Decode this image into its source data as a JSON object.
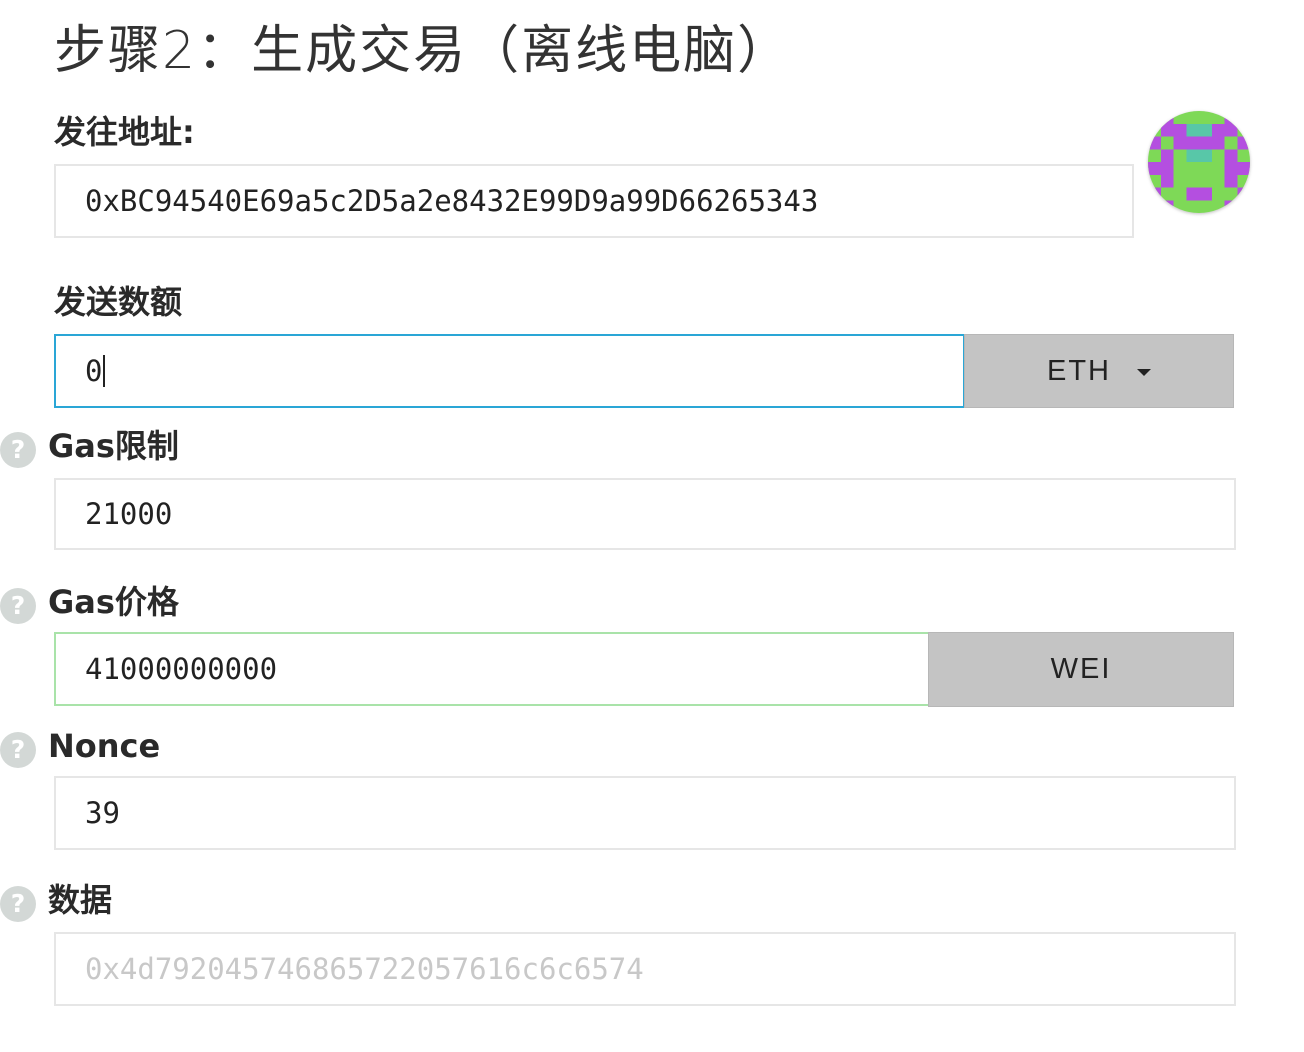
{
  "page": {
    "title": "步骤2：生成交易（离线电脑）"
  },
  "to_address": {
    "label": "发往地址:",
    "value": "0xBC94540E69a5c2D5a2e8432E99D9a99D66265343",
    "identicon": {
      "icon": "address-identicon",
      "colors": {
        "background": "#7ed957",
        "primary": "#b44fe0",
        "spot": "#58c7a8"
      }
    }
  },
  "amount": {
    "label": "发送数额",
    "value": "0",
    "unit": "ETH"
  },
  "gas_limit": {
    "help": "?",
    "label": "Gas限制",
    "value": "21000"
  },
  "gas_price": {
    "help": "?",
    "label": "Gas价格",
    "value": "41000000000",
    "unit": "WEI"
  },
  "nonce": {
    "help": "?",
    "label": "Nonce",
    "value": "39"
  },
  "data": {
    "help": "?",
    "label": "数据",
    "placeholder": "0x4d792045746865722057616c6c6574"
  },
  "colors": {
    "focus_border": "#2aa6d6",
    "valid_border": "#a9e3a9",
    "unit_background": "#c4c4c4",
    "help_icon": "#d3d8d6"
  }
}
